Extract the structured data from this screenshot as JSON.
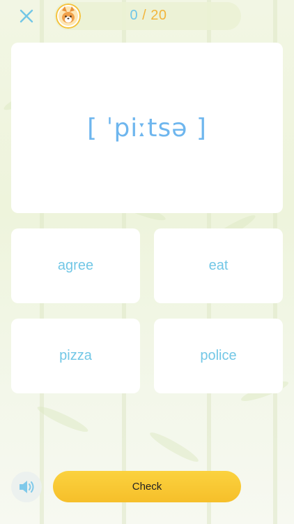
{
  "header": {
    "close_icon": "close-icon",
    "avatar_icon": "corgi-avatar-icon",
    "progress": {
      "current": "0",
      "separator": "/",
      "total": "20"
    }
  },
  "question": {
    "phonetic": "[ ˈpiːtsə ]"
  },
  "options": [
    {
      "label": "agree"
    },
    {
      "label": "eat"
    },
    {
      "label": "pizza"
    },
    {
      "label": "police"
    }
  ],
  "footer": {
    "sound_icon": "speaker-icon",
    "check_label": "Check"
  },
  "colors": {
    "accent_blue": "#6fc6e8",
    "progress_gold": "#f2b53c",
    "button_yellow": "#f8c832",
    "background": "#eef4dc"
  }
}
